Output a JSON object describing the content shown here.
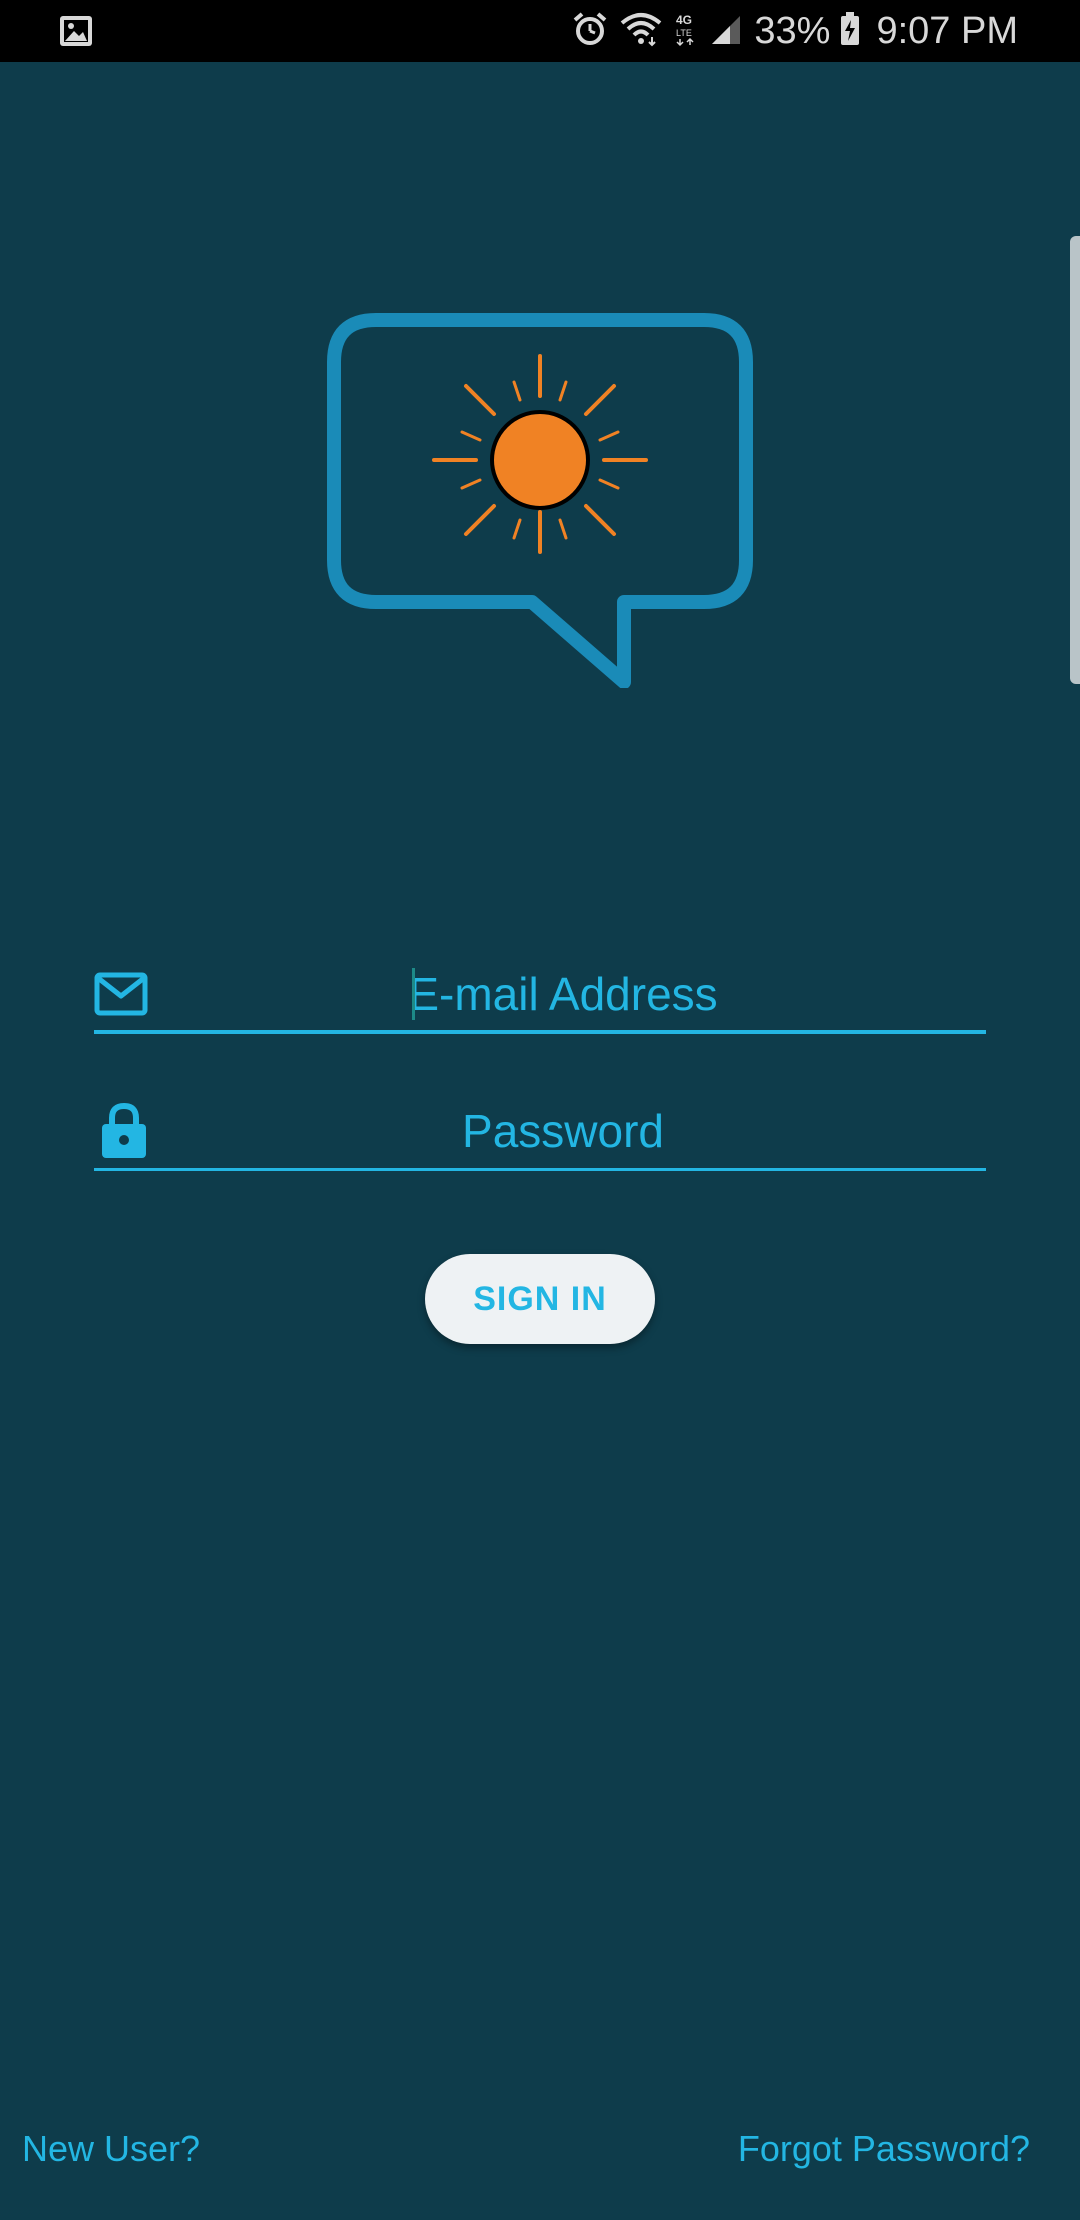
{
  "status_bar": {
    "notification_icon": "image-icon",
    "icons": [
      "alarm-icon",
      "wifi-icon",
      "4g-lte-icon",
      "cell-signal-icon"
    ],
    "battery_percent": "33%",
    "battery_icon": "battery-charging-icon",
    "time": "9:07 PM"
  },
  "logo": {
    "icon": "chat-bubble-sun-logo",
    "colors": {
      "bubble": "#1a8bb8",
      "sun": "#f08224",
      "rays": "#f08224"
    }
  },
  "login_form": {
    "email": {
      "icon": "mail-icon",
      "placeholder": "E-mail Address",
      "value": ""
    },
    "password": {
      "icon": "lock-icon",
      "placeholder": "Password",
      "value": ""
    },
    "sign_in_label": "SIGN IN"
  },
  "footer": {
    "new_user_label": "New User?",
    "forgot_password_label": "Forgot Password?"
  },
  "theme": {
    "background": "#0e3c4b",
    "accent": "#23b6e3",
    "button_bg": "#eef2f4"
  }
}
